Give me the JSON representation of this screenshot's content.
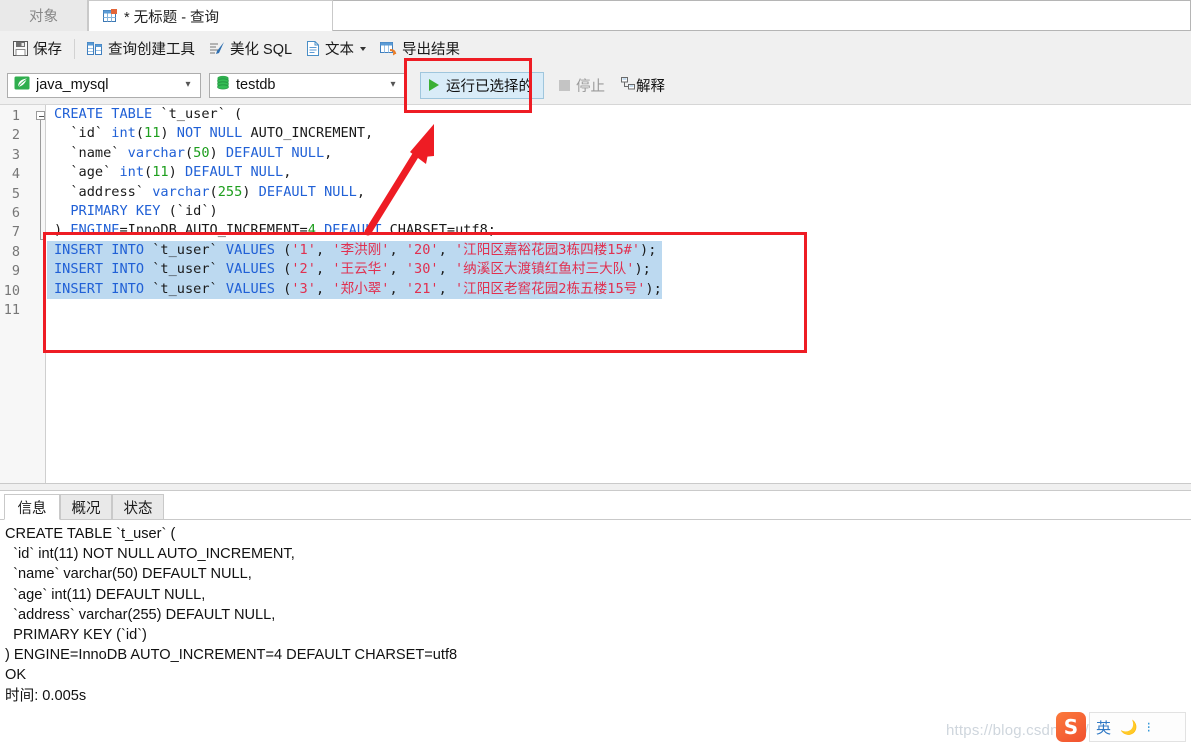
{
  "window": {
    "app": "Navicat",
    "tabs": [
      {
        "label": "对象",
        "icon": "objects-icon",
        "active": false
      },
      {
        "label": "* 无标题 - 查询",
        "icon": "query-table-icon",
        "active": true
      }
    ]
  },
  "toolbar": {
    "save_label": "保存",
    "save_icon": "save-disk-icon",
    "query_builder_label": "查询创建工具",
    "query_builder_icon": "query-builder-icon",
    "beautify_label": "美化 SQL",
    "beautify_icon": "beautify-pen-icon",
    "text_label": "文本",
    "text_icon": "text-document-icon",
    "export_label": "导出结果",
    "export_icon": "export-results-icon"
  },
  "connbar": {
    "connection_value": "java_mysql",
    "connection_icon": "connection-leaf-icon",
    "database_value": "testdb",
    "database_icon": "database-cylinder-icon",
    "run_selected_label": "运行已选择的",
    "run_icon": "play-triangle-icon",
    "stop_label": "停止",
    "stop_icon": "stop-square-icon",
    "explain_label": "解释",
    "explain_icon": "explain-plan-icon"
  },
  "editor": {
    "line_numbers": [
      "1",
      "2",
      "3",
      "4",
      "5",
      "6",
      "7",
      "8",
      "9",
      "10",
      "11"
    ],
    "fold_marker": "collapse-box-icon",
    "lines": [
      {
        "n": 1,
        "selected": false,
        "tokens": [
          {
            "t": "CREATE",
            "c": "kw"
          },
          {
            "t": " ",
            "c": "pl"
          },
          {
            "t": "TABLE",
            "c": "kw"
          },
          {
            "t": " `t_user` (",
            "c": "pl"
          }
        ]
      },
      {
        "n": 2,
        "selected": false,
        "tokens": [
          {
            "t": "  `id` ",
            "c": "pl"
          },
          {
            "t": "int",
            "c": "kw"
          },
          {
            "t": "(",
            "c": "pl"
          },
          {
            "t": "11",
            "c": "num"
          },
          {
            "t": ") ",
            "c": "pl"
          },
          {
            "t": "NOT",
            "c": "kw"
          },
          {
            "t": " ",
            "c": "pl"
          },
          {
            "t": "NULL",
            "c": "kw"
          },
          {
            "t": " AUTO_INCREMENT,",
            "c": "pl"
          }
        ]
      },
      {
        "n": 3,
        "selected": false,
        "tokens": [
          {
            "t": "  `name` ",
            "c": "pl"
          },
          {
            "t": "varchar",
            "c": "kw"
          },
          {
            "t": "(",
            "c": "pl"
          },
          {
            "t": "50",
            "c": "num"
          },
          {
            "t": ") ",
            "c": "pl"
          },
          {
            "t": "DEFAULT",
            "c": "kw"
          },
          {
            "t": " ",
            "c": "pl"
          },
          {
            "t": "NULL",
            "c": "kw"
          },
          {
            "t": ",",
            "c": "pl"
          }
        ]
      },
      {
        "n": 4,
        "selected": false,
        "tokens": [
          {
            "t": "  `age` ",
            "c": "pl"
          },
          {
            "t": "int",
            "c": "kw"
          },
          {
            "t": "(",
            "c": "pl"
          },
          {
            "t": "11",
            "c": "num"
          },
          {
            "t": ") ",
            "c": "pl"
          },
          {
            "t": "DEFAULT",
            "c": "kw"
          },
          {
            "t": " ",
            "c": "pl"
          },
          {
            "t": "NULL",
            "c": "kw"
          },
          {
            "t": ",",
            "c": "pl"
          }
        ]
      },
      {
        "n": 5,
        "selected": false,
        "tokens": [
          {
            "t": "  `address` ",
            "c": "pl"
          },
          {
            "t": "varchar",
            "c": "kw"
          },
          {
            "t": "(",
            "c": "pl"
          },
          {
            "t": "255",
            "c": "num"
          },
          {
            "t": ") ",
            "c": "pl"
          },
          {
            "t": "DEFAULT",
            "c": "kw"
          },
          {
            "t": " ",
            "c": "pl"
          },
          {
            "t": "NULL",
            "c": "kw"
          },
          {
            "t": ",",
            "c": "pl"
          }
        ]
      },
      {
        "n": 6,
        "selected": false,
        "tokens": [
          {
            "t": "  ",
            "c": "pl"
          },
          {
            "t": "PRIMARY",
            "c": "kw"
          },
          {
            "t": " ",
            "c": "pl"
          },
          {
            "t": "KEY",
            "c": "kw"
          },
          {
            "t": " (`id`)",
            "c": "pl"
          }
        ]
      },
      {
        "n": 7,
        "selected": false,
        "tokens": [
          {
            "t": ") ",
            "c": "pl"
          },
          {
            "t": "ENGINE",
            "c": "kw"
          },
          {
            "t": "=InnoDB AUTO_INCREMENT=",
            "c": "pl"
          },
          {
            "t": "4",
            "c": "num"
          },
          {
            "t": " ",
            "c": "pl"
          },
          {
            "t": "DEFAULT",
            "c": "kw"
          },
          {
            "t": " CHARSET=utf8;",
            "c": "pl"
          }
        ]
      },
      {
        "n": 8,
        "selected": true,
        "tokens": [
          {
            "t": "INSERT",
            "c": "kw"
          },
          {
            "t": " ",
            "c": "pl"
          },
          {
            "t": "INTO",
            "c": "kw"
          },
          {
            "t": " `t_user` ",
            "c": "pl"
          },
          {
            "t": "VALUES",
            "c": "kw"
          },
          {
            "t": " (",
            "c": "pl"
          },
          {
            "t": "'1'",
            "c": "str"
          },
          {
            "t": ", ",
            "c": "pl"
          },
          {
            "t": "'李洪刚'",
            "c": "str"
          },
          {
            "t": ", ",
            "c": "pl"
          },
          {
            "t": "'20'",
            "c": "str"
          },
          {
            "t": ", ",
            "c": "pl"
          },
          {
            "t": "'江阳区嘉裕花园3栋四楼15#'",
            "c": "str"
          },
          {
            "t": ");",
            "c": "pl"
          }
        ]
      },
      {
        "n": 9,
        "selected": true,
        "tokens": [
          {
            "t": "INSERT",
            "c": "kw"
          },
          {
            "t": " ",
            "c": "pl"
          },
          {
            "t": "INTO",
            "c": "kw"
          },
          {
            "t": " `t_user` ",
            "c": "pl"
          },
          {
            "t": "VALUES",
            "c": "kw"
          },
          {
            "t": " (",
            "c": "pl"
          },
          {
            "t": "'2'",
            "c": "str"
          },
          {
            "t": ", ",
            "c": "pl"
          },
          {
            "t": "'王云华'",
            "c": "str"
          },
          {
            "t": ", ",
            "c": "pl"
          },
          {
            "t": "'30'",
            "c": "str"
          },
          {
            "t": ", ",
            "c": "pl"
          },
          {
            "t": "'纳溪区大渡镇红鱼村三大队'",
            "c": "str"
          },
          {
            "t": ");",
            "c": "pl"
          }
        ]
      },
      {
        "n": 10,
        "selected": true,
        "tokens": [
          {
            "t": "INSERT",
            "c": "kw"
          },
          {
            "t": " ",
            "c": "pl"
          },
          {
            "t": "INTO",
            "c": "kw"
          },
          {
            "t": " `t_user` ",
            "c": "pl"
          },
          {
            "t": "VALUES",
            "c": "kw"
          },
          {
            "t": " (",
            "c": "pl"
          },
          {
            "t": "'3'",
            "c": "str"
          },
          {
            "t": ", ",
            "c": "pl"
          },
          {
            "t": "'郑小翠'",
            "c": "str"
          },
          {
            "t": ", ",
            "c": "pl"
          },
          {
            "t": "'21'",
            "c": "str"
          },
          {
            "t": ", ",
            "c": "pl"
          },
          {
            "t": "'江阳区老窖花园2栋五楼15号'",
            "c": "str"
          },
          {
            "t": ");",
            "c": "pl"
          }
        ]
      },
      {
        "n": 11,
        "selected": false,
        "tokens": []
      }
    ]
  },
  "result": {
    "tabs": [
      {
        "label": "信息",
        "active": true
      },
      {
        "label": "概况",
        "active": false
      },
      {
        "label": "状态",
        "active": false
      }
    ],
    "log": "CREATE TABLE `t_user` (\n  `id` int(11) NOT NULL AUTO_INCREMENT,\n  `name` varchar(50) DEFAULT NULL,\n  `age` int(11) DEFAULT NULL,\n  `address` varchar(255) DEFAULT NULL,\n  PRIMARY KEY (`id`)\n) ENGINE=InnoDB AUTO_INCREMENT=4 DEFAULT CHARSET=utf8\nOK\n时间: 0.005s"
  },
  "annotations": {
    "run_box_color": "#ee1c24",
    "code_box_color": "#ee1c24",
    "arrow_color": "#ee1c24"
  },
  "overlay": {
    "watermark_text": "https://blog.csdn.net/qsqrewqgsn",
    "ime_logo_text": "S",
    "ime_mode_text": "英",
    "ime_moon_icon": "moon-icon",
    "ime_dots_icon": "more-dots-icon"
  },
  "colors": {
    "keyword": "#2060d6",
    "number": "#1d9e1d",
    "string": "#e03050",
    "selection": "#bcd9f0",
    "accent_red": "#ee1c24",
    "run_green": "#3cb034"
  }
}
